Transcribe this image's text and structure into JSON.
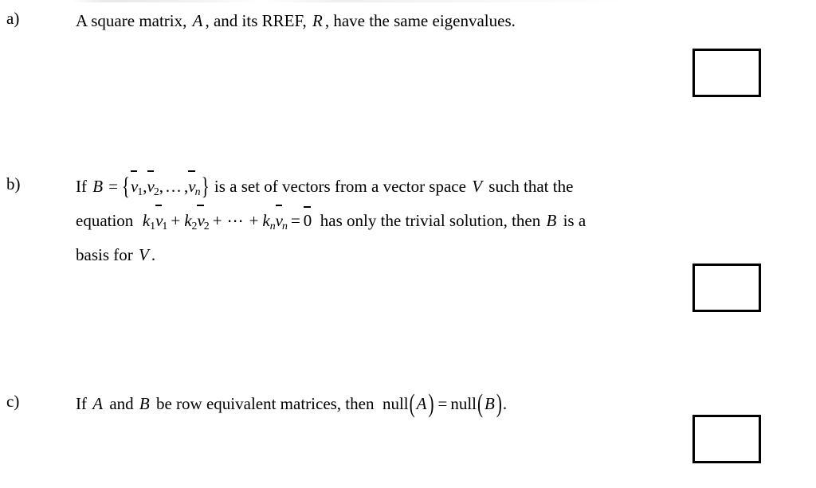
{
  "document": {
    "type": "true-false-question-sheet",
    "background_color": "#ffffff",
    "text_color": "#000000"
  },
  "questions": [
    {
      "label": "a)",
      "answer_box_placeholder": "",
      "lines": [
        {
          "plain_text": "A square matrix, A , and its RREF, R , have the same eigenvalues.",
          "parts": {
            "t1": "A square matrix,",
            "m1": "A",
            "t2": ", and its RREF,",
            "m2": "R",
            "t3": ", have the same eigenvalues."
          }
        }
      ]
    },
    {
      "label": "b)",
      "answer_box_placeholder": "",
      "lines": [
        {
          "plain_text": "If B = {v1, v2, ..., vn} is a set of vectors from a vector space V such that the",
          "parts": {
            "t1": "If",
            "m1": "B",
            "eq": "=",
            "brace_open": "{",
            "v": "v",
            "s1": "1",
            "comma1": ",",
            "s2": "2",
            "comma2": ",",
            "ellipsis": "…",
            "comma3": ",",
            "sn": "n",
            "brace_close": "}",
            "t2": "is a set of vectors from a vector space",
            "m2": "V",
            "t3": "such that the"
          }
        },
        {
          "plain_text": "equation k1v1 + k2v2 + ... + knvn = 0 has only the trivial solution, then B is a",
          "parts": {
            "t1": "equation",
            "k": "k",
            "v": "v",
            "s1": "1",
            "s2": "2",
            "sn": "n",
            "plus": "+",
            "ellipsis": "⋯",
            "eq": "=",
            "zero": "0",
            "t2": "has only the trivial solution, then",
            "m1": "B",
            "t3": "is a"
          }
        },
        {
          "plain_text": "basis for V .",
          "parts": {
            "t1": "basis for",
            "m1": "V",
            "t2": "."
          }
        }
      ]
    },
    {
      "label": "c)",
      "answer_box_placeholder": "",
      "lines": [
        {
          "plain_text": "If A and B be row equivalent matrices, then null(A) = null(B).",
          "parts": {
            "t1": "If",
            "m1": "A",
            "t2": "and",
            "m2": "B",
            "t3": "be row equivalent matrices, then",
            "func1": "null",
            "paren_open": "(",
            "m3": "A",
            "paren_close": ")",
            "eq": "=",
            "func2": "null",
            "m4": "B",
            "period": "."
          }
        }
      ]
    }
  ]
}
